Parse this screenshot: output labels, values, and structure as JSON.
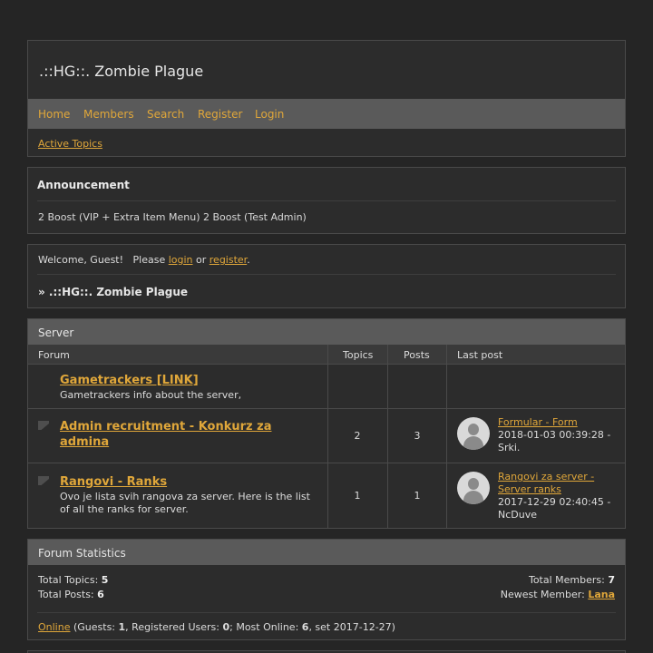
{
  "site": {
    "title": ".::HG::. Zombie Plague"
  },
  "nav": {
    "items": [
      "Home",
      "Members",
      "Search",
      "Register",
      "Login"
    ],
    "active_topics": "Active Topics"
  },
  "announcement": {
    "title": "Announcement",
    "text": "2 Boost (VIP + Extra Item Menu) 2 Boost (Test Admin)"
  },
  "welcome": {
    "prefix": "Welcome, Guest!   Please ",
    "login": "login",
    "or": " or ",
    "register": "register",
    "suffix": ".",
    "breadcrumb": "» .::HG::. Zombie Plague"
  },
  "forum": {
    "category": "Server",
    "columns": {
      "forum": "Forum",
      "topics": "Topics",
      "posts": "Posts",
      "last_post": "Last post"
    },
    "rows": [
      {
        "title": "Gametrackers [LINK]",
        "description": "Gametrackers info about the server,",
        "topics": "",
        "posts": "",
        "last_post": null
      },
      {
        "title": "Admin recruitment - Konkurz za admina",
        "description": "",
        "topics": "2",
        "posts": "3",
        "last_post": {
          "topic": "Formular - Form",
          "date": "2018-01-03 00:39:28 -",
          "user": "Srki."
        }
      },
      {
        "title": "Rangovi - Ranks",
        "description": "Ovo je lista svih rangova za server. Here is the list of all the ranks for server.",
        "topics": "1",
        "posts": "1",
        "last_post": {
          "topic": "Rangovi za server - Server ranks",
          "date": "2017-12-29 02:40:45 -",
          "user": "NcDuve"
        }
      }
    ]
  },
  "stats": {
    "title": "Forum Statistics",
    "total_topics_label": "Total Topics: ",
    "total_topics": "5",
    "total_posts_label": "Total Posts: ",
    "total_posts": "6",
    "total_members_label": "Total Members: ",
    "total_members": "7",
    "newest_member_label": "Newest Member: ",
    "newest_member": "Lana",
    "online_link": "Online",
    "online_guests_label": " (Guests: ",
    "guests": "1",
    "registered_label": ", Registered Users: ",
    "registered": "0",
    "most_online_label": "; Most Online: ",
    "most_online": "6",
    "most_online_date": ", set 2017-12-27)"
  },
  "colors": {
    "accent": "#e0a73a",
    "background": "#252525",
    "panel": "#2c2c2c",
    "bar": "#5a5a5a"
  }
}
